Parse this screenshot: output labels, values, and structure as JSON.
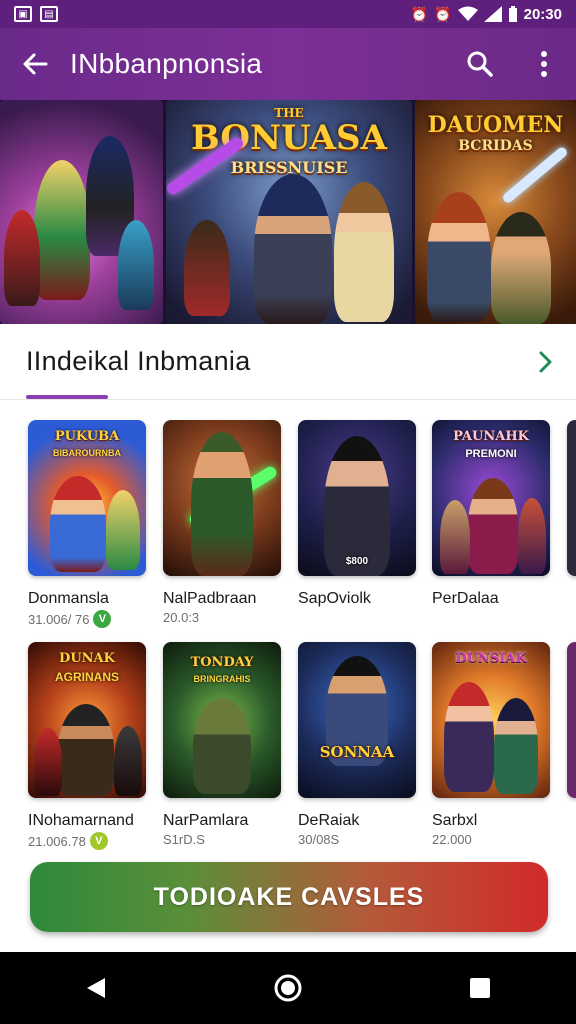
{
  "status_bar": {
    "time": "20:30",
    "left_icons": [
      "photo-icon",
      "gallery-icon"
    ],
    "right_icons": [
      "alarm-icon",
      "alarm-icon",
      "wifi-icon",
      "signal-icon",
      "battery-icon"
    ]
  },
  "app_bar": {
    "title": "INbbanpnonsia",
    "back_icon": "arrow-left-icon",
    "search_icon": "search-icon",
    "more_icon": "more-vert-icon"
  },
  "banner": {
    "cards": [
      {
        "title": ""
      },
      {
        "title": "BONUASA",
        "top_label": "THE",
        "subtitle": "BRISSNUISE"
      },
      {
        "title": "DAUOMEN",
        "subtitle": "BCRIDAS"
      }
    ]
  },
  "section": {
    "title": "IIndeikal Inbmania",
    "chevron_icon": "chevron-right-icon"
  },
  "tiles": [
    {
      "art_title": "PUKUBA",
      "art_sub": "BIBAROURNBA",
      "name": "Donmansla",
      "meta": "31.006/ 76",
      "badge": "V",
      "accent": "#2d5bd6"
    },
    {
      "art_title": "",
      "art_sub": "",
      "name": "NalPadbraan",
      "meta": "20.0:3",
      "badge": "",
      "accent": "#7a3a1c"
    },
    {
      "art_title": "",
      "art_sub": "$800",
      "name": "SapOviolk",
      "meta": "",
      "badge": "",
      "accent": "#1d1f4a"
    },
    {
      "art_title": "PAUNAHK",
      "art_sub": "PREMONI",
      "name": "PerDalaa",
      "meta": "",
      "badge": "",
      "accent": "#2a2b6a"
    },
    {
      "art_title": "DUNAK",
      "art_sub": "AGRINANS",
      "name": "INohamarnand",
      "meta": "21.006.78",
      "badge": "V",
      "accent": "#7a2a10"
    },
    {
      "art_title": "TONDAY",
      "art_sub": "BRINGRAHIS",
      "name": "NarPamlara",
      "meta": "S1rD.S",
      "badge": "",
      "accent": "#2a5a2a"
    },
    {
      "art_title": "SONNAA",
      "art_sub": "",
      "name": "DeRaiak",
      "meta": "30/08S",
      "badge": "",
      "accent": "#1c2b5a"
    },
    {
      "art_title": "DUNSIAK",
      "art_sub": "",
      "name": "Sarbxl",
      "meta": "22.000",
      "badge": "",
      "accent": "#c8541c"
    }
  ],
  "cta": {
    "label": "TODIOAKE CAVSLES"
  },
  "nav": {
    "back_icon": "nav-back-icon",
    "home_icon": "nav-home-icon",
    "recents_icon": "nav-recents-icon"
  },
  "colors": {
    "status_bar": "#5f1f7c",
    "app_bar": "#7c2f96",
    "section_underline": "#8c3fb0",
    "chevron": "#1e8a55",
    "cta_start": "#2c8a3a",
    "cta_end": "#d12a2a",
    "badge": "#3aa843"
  }
}
